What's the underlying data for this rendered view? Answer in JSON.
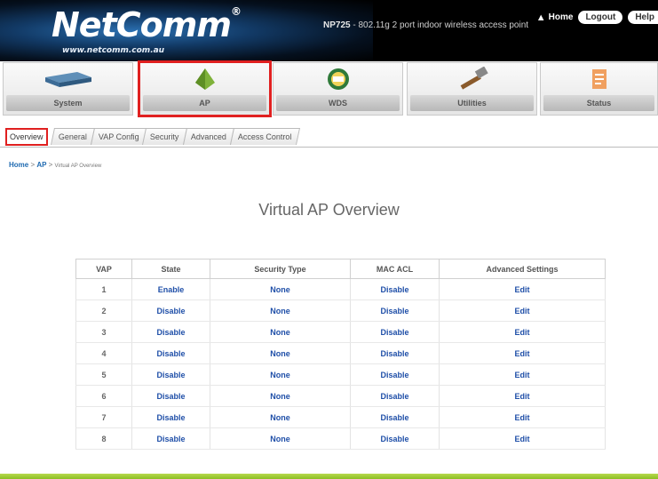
{
  "header": {
    "logo_text": "NetComm",
    "logo_reg": "®",
    "logo_url": "www.netcomm.com.au",
    "model_code": "NP725",
    "model_desc": " - 802.11g 2 port indoor wireless access point",
    "home_label": "Home",
    "logout_label": "Logout",
    "help_label": "Help"
  },
  "nav": [
    {
      "label": "System",
      "icon": "router-icon"
    },
    {
      "label": "AP",
      "icon": "access-point-icon"
    },
    {
      "label": "WDS",
      "icon": "wds-icon"
    },
    {
      "label": "Utilities",
      "icon": "hammer-icon"
    },
    {
      "label": "Status",
      "icon": "status-icon"
    }
  ],
  "tabs": [
    "Overview",
    "General",
    "VAP Config",
    "Security",
    "Advanced",
    "Access Control"
  ],
  "breadcrumb": {
    "home": "Home",
    "section": "AP",
    "current": "Virtual AP Overview"
  },
  "page_title": "Virtual AP Overview",
  "table": {
    "headers": [
      "VAP",
      "State",
      "Security Type",
      "MAC ACL",
      "Advanced Settings"
    ],
    "rows": [
      [
        "1",
        "Enable",
        "None",
        "Disable",
        "Edit"
      ],
      [
        "2",
        "Disable",
        "None",
        "Disable",
        "Edit"
      ],
      [
        "3",
        "Disable",
        "None",
        "Disable",
        "Edit"
      ],
      [
        "4",
        "Disable",
        "None",
        "Disable",
        "Edit"
      ],
      [
        "5",
        "Disable",
        "None",
        "Disable",
        "Edit"
      ],
      [
        "6",
        "Disable",
        "None",
        "Disable",
        "Edit"
      ],
      [
        "7",
        "Disable",
        "None",
        "Disable",
        "Edit"
      ],
      [
        "8",
        "Disable",
        "None",
        "Disable",
        "Edit"
      ]
    ]
  },
  "colors": {
    "highlight": "#e02020",
    "link": "#1f4fa8",
    "footer": "#8bbf23"
  }
}
